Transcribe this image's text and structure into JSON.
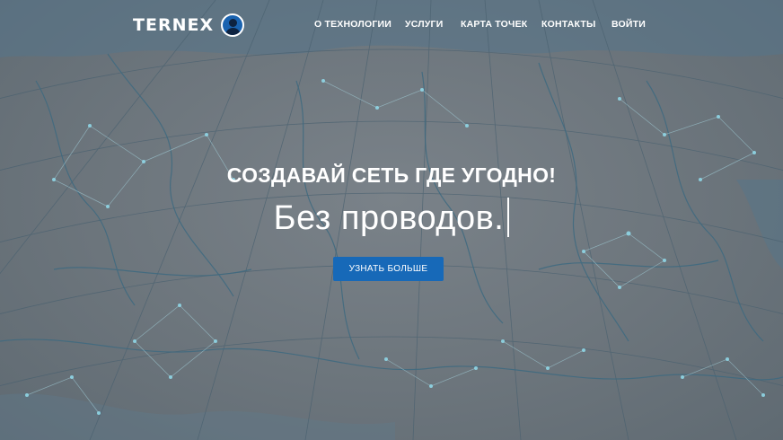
{
  "brand": {
    "name": "TERNEX",
    "icon": "user-avatar-icon"
  },
  "nav": {
    "items": [
      "О ТЕХНОЛОГИИ",
      "УСЛУГИ",
      "КАРТА ТОЧЕК",
      "КОНТАКТЫ",
      "ВОЙТИ"
    ]
  },
  "hero": {
    "headline": "СОЗДАВАЙ СЕТЬ ГДЕ УГОДНО!",
    "subline": "Без проводов.",
    "cta_label": "УЗНАТЬ БОЛЬШЕ",
    "background": "map-of-russia-network-background"
  },
  "colors": {
    "accent": "#1769b8",
    "overlay": "#6c757c",
    "map_lines": "#3f6a80",
    "network_nodes": "#8fd6e6"
  }
}
